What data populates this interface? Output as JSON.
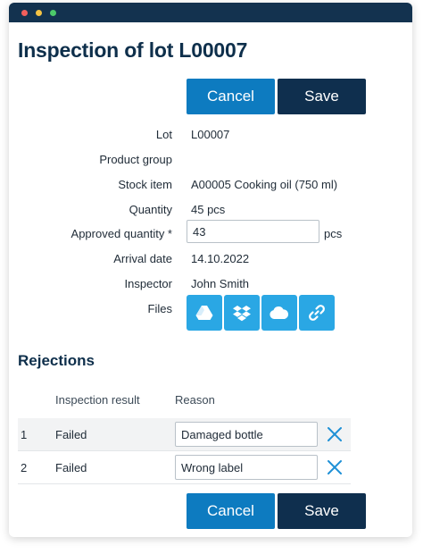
{
  "form": {
    "title": "Inspection of lot L00007",
    "actions": {
      "cancel_label": "Cancel",
      "save_label": "Save"
    },
    "fields": {
      "lot": {
        "label": "Lot",
        "value": "L00007"
      },
      "product_group": {
        "label": "Product group",
        "value": ""
      },
      "stock_item": {
        "label": "Stock item",
        "value": "A00005 Cooking oil (750 ml)"
      },
      "quantity": {
        "label": "Quantity",
        "value": "45 pcs"
      },
      "approved_quantity": {
        "label": "Approved quantity *",
        "value": "43",
        "unit": "pcs"
      },
      "arrival_date": {
        "label": "Arrival date",
        "value": "14.10.2022"
      },
      "inspector": {
        "label": "Inspector",
        "value": "John Smith"
      },
      "files": {
        "label": "Files",
        "icons": [
          "google-drive-icon",
          "dropbox-icon",
          "cloud-icon",
          "link-icon"
        ]
      }
    }
  },
  "rejections": {
    "title": "Rejections",
    "columns": [
      "Inspection result",
      "Reason"
    ],
    "rows": [
      {
        "num": "1",
        "result": "Failed",
        "reason": "Damaged bottle"
      },
      {
        "num": "2",
        "result": "Failed",
        "reason": "Wrong label"
      }
    ]
  },
  "colors": {
    "titlebar": "#13324f",
    "primary_dark": "#0f2f4e",
    "primary_blue": "#0d7bc0",
    "file_button": "#2aa7e4",
    "delete_icon": "#1e90d6"
  }
}
